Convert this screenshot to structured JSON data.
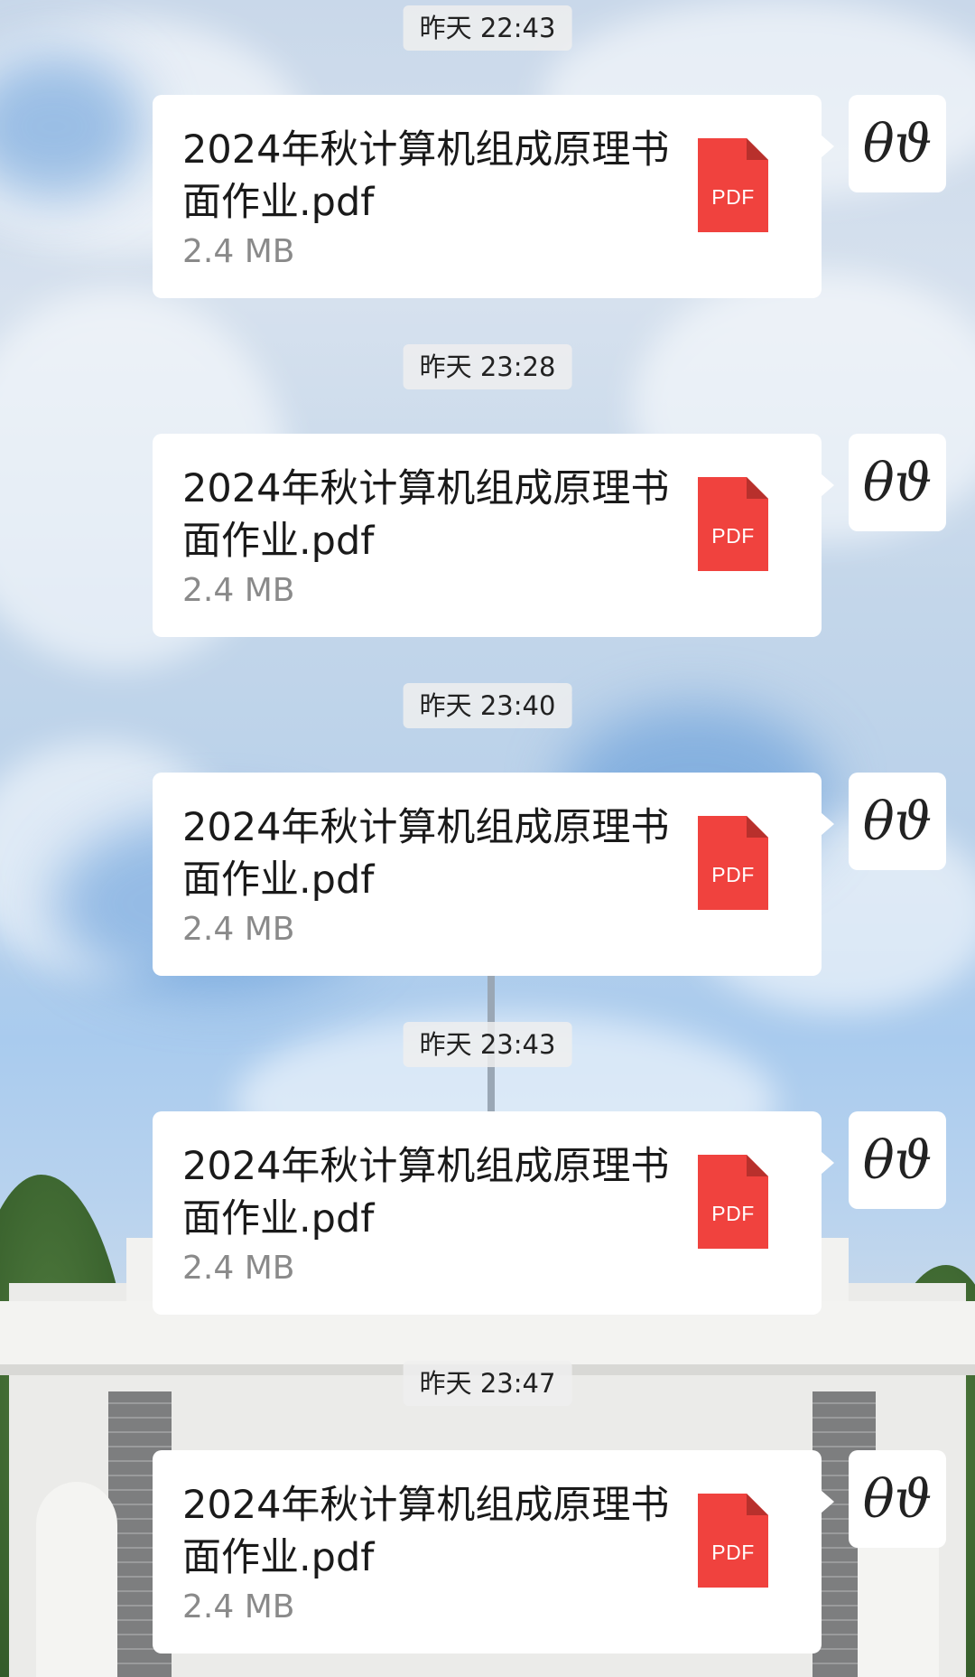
{
  "chat": {
    "avatar_text": "θϑ",
    "pdf_label": "PDF",
    "messages": [
      {
        "time": "昨天 22:43",
        "file_name": "2024年秋计算机组成原理书面作业.pdf",
        "file_size": "2.4 MB"
      },
      {
        "time": "昨天 23:28",
        "file_name": "2024年秋计算机组成原理书面作业.pdf",
        "file_size": "2.4 MB"
      },
      {
        "time": "昨天 23:40",
        "file_name": "2024年秋计算机组成原理书面作业.pdf",
        "file_size": "2.4 MB"
      },
      {
        "time": "昨天 23:43",
        "file_name": "2024年秋计算机组成原理书面作业.pdf",
        "file_size": "2.4 MB"
      },
      {
        "time": "昨天 23:47",
        "file_name": "2024年秋计算机组成原理书面作业.pdf",
        "file_size": "2.4 MB"
      }
    ]
  },
  "colors": {
    "pdf_red": "#f0423e",
    "pdf_fold": "#b8302c",
    "bubble_bg": "#ffffff",
    "timestamp_bg": "#eeeeee"
  },
  "icons": {
    "file_icon": "pdf-file-icon",
    "avatar": "user-avatar"
  }
}
